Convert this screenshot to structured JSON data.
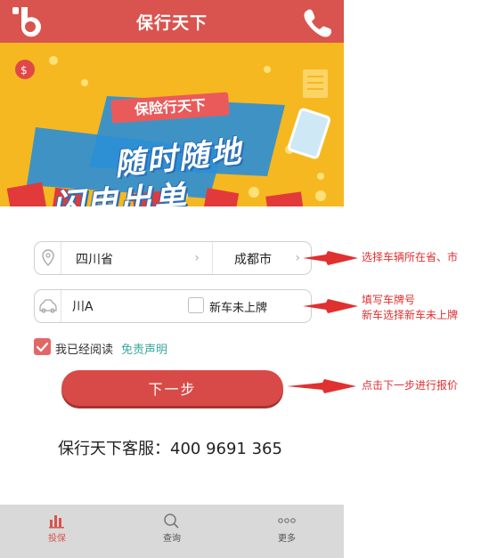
{
  "header": {
    "title": "保行天下",
    "logo_icon": "brand-b-logo-icon",
    "phone_icon": "phone-icon"
  },
  "banner": {
    "tag": "保险行天下",
    "line1": "随时随地",
    "line2": "闪电出单"
  },
  "form": {
    "province": "四川省",
    "city": "成都市",
    "plate_value": "川A",
    "new_car_label": "新车未上牌",
    "new_car_checked": false,
    "agree_text": "我已经阅读",
    "agree_link": "免责声明",
    "agree_checked": true,
    "next_label": "下一步"
  },
  "service": {
    "text": "保行天下客服：400 9691 365"
  },
  "tabs": [
    {
      "label": "投保",
      "icon": "bar-chart-icon",
      "active": true
    },
    {
      "label": "查询",
      "icon": "search-icon",
      "active": false
    },
    {
      "label": "更多",
      "icon": "more-dots-icon",
      "active": false
    }
  ],
  "annotations": {
    "region": "选择车辆所在省、市",
    "plate_line1": "填写车牌号",
    "plate_line2": "新车选择新车未上牌",
    "next": "点击下一步进行报价"
  },
  "colors": {
    "header_red": "#d9534f",
    "banner_yellow": "#f6b820",
    "link_teal": "#3aa99f",
    "annotation_red": "#e03030",
    "tabbar_gray": "#d9d9d9"
  }
}
